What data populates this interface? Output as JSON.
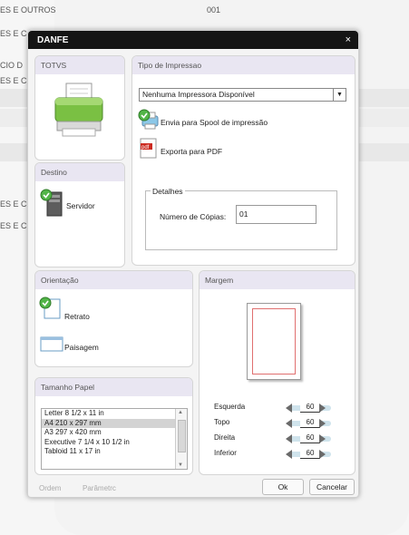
{
  "background": {
    "rows": [
      "ES E OUTROS",
      "001",
      "ES E C",
      "CIO D",
      "ES E C",
      "ES E C",
      "ES E C"
    ]
  },
  "dialog": {
    "title": "DANFE",
    "close_label": "×",
    "totvs": {
      "header": "TOTVS"
    },
    "tipo": {
      "header": "Tipo de Impressao",
      "printer_select": "Nenhuma Impressora Disponível",
      "spool_label": "Envia para Spool de impressão",
      "pdf_label": "Exporta para PDF",
      "pdf_icon_text": "pdf",
      "details_legend": "Detalhes",
      "copies_label": "Número de Cópias:",
      "copies_value": "01"
    },
    "destino": {
      "header": "Destino",
      "server_label": "Servidor"
    },
    "orientacao": {
      "header": "Orientação",
      "retrato": "Retrato",
      "paisagem": "Paisagem"
    },
    "margem": {
      "header": "Margem",
      "rows": [
        {
          "label": "Esquerda",
          "value": "60"
        },
        {
          "label": "Topo",
          "value": "60"
        },
        {
          "label": "Direita",
          "value": "60"
        },
        {
          "label": "Inferior",
          "value": "60"
        }
      ]
    },
    "tamanho": {
      "header": "Tamanho Papel",
      "items": [
        "Letter 8 1/2 x 11 in",
        "A4 210 x 297 mm",
        "A3 297 x 420 mm",
        "Executive 7 1/4 x 10 1/2 in",
        "Tabloid 11 x 17 in"
      ],
      "selected": "A4 210 x 297 mm"
    },
    "footer": {
      "ordem": "Ordem",
      "parametros": "Parâmetrc",
      "ok": "Ok",
      "cancel": "Cancelar"
    }
  }
}
